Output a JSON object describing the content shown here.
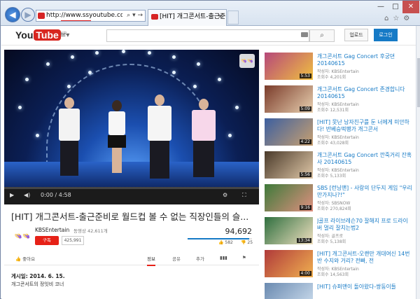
{
  "browser": {
    "url": "http://www.ssyoutube.com/watch?v=",
    "addr_tools": "⌕ ▾ →",
    "tab_title": "[HIT] 개그콘서트-출근준비...",
    "tab_close": "×",
    "min": "—",
    "max": "□",
    "close": "✕",
    "right_icons": "⌂☆⚙"
  },
  "header": {
    "logo_you": "You",
    "logo_tube": "Tube",
    "logo_region": "KR",
    "menu_icon": "≡▾",
    "search_icon": "⌕",
    "upload": "업로드",
    "login": "로그인"
  },
  "player": {
    "badge": "👒👒",
    "time": "0:00 / 4:58",
    "play_icon": "▶",
    "volume_icon": "◀)",
    "settings_icon": "⚙",
    "fullscreen_icon": "⛶",
    "progress": 0.0
  },
  "video": {
    "title": "[HIT] 개그콘서트-출근준비로 월드컵 볼 수 없는 직장인들의 슬...",
    "channel_avatar": "👒👒",
    "channel": "KBSEntertain",
    "video_count": "동영상 42,611개",
    "subscribe": "구독",
    "subscribers": "425,991",
    "views": "94,692",
    "like_ratio": 0.96,
    "likes": "👍 582",
    "dislikes": "👎 25",
    "publish_date": "게시일: 2014. 6. 15.",
    "description": "개그콘서트의 정잇비 코너"
  },
  "actions": {
    "like": "좋아요",
    "about": "정보",
    "share": "공유",
    "add": "추가",
    "stats": "▮▮▮",
    "flag": "⚑"
  },
  "recommended": [
    {
      "title": "개그콘서트 Gag Concert 후궁뎐 20140615",
      "by": "작성자: KBSEntertain",
      "views": "조회수 4,201회",
      "duration": "5:53"
    },
    {
      "title": "개그콘서트 Gag Concert 존경합니다 20140615",
      "by": "작성자: KBSEntertain",
      "views": "조회수 12,531회",
      "duration": "5:09"
    },
    {
      "title": "[HIT] 못난 남자친구를 둔 너에게 미안하다! 반베승떡팽가 개그콘서",
      "by": "작성자: KBSEntertain",
      "views": "조회수 43,028회",
      "duration": "4:22"
    },
    {
      "title": "개그콘서트 Gag Concert 깐죽거리 잔혹사 20140615",
      "by": "작성자: KBSEntertain",
      "views": "조회수 5,133회",
      "duration": "5:56"
    },
    {
      "title": "SBS [런닝맨] - 사랑의 단두지 게임 \"우리 만가지나?!\"",
      "by": "작성자: SBSNOW",
      "views": "조회수 270,824회",
      "duration": "9:16"
    },
    {
      "title": "J골프 라이브레슨70 잘해지 프로 드라이버 멀리 잘치는법2",
      "by": "작성자: 골프로",
      "views": "조회수 5,138회",
      "duration": "13:34"
    },
    {
      "title": "[HIT] 개그콘서트-오랜만 개대여신 14번반 수지와 거리? 전빠, 전",
      "by": "작성자: KBSEntertain",
      "views": "조회수 14,563회",
      "duration": "4:00"
    },
    {
      "title": "[HIT] 슈퍼맨이 돌아왔다-쌍둥이들",
      "by": "",
      "views": "",
      "duration": ""
    }
  ]
}
